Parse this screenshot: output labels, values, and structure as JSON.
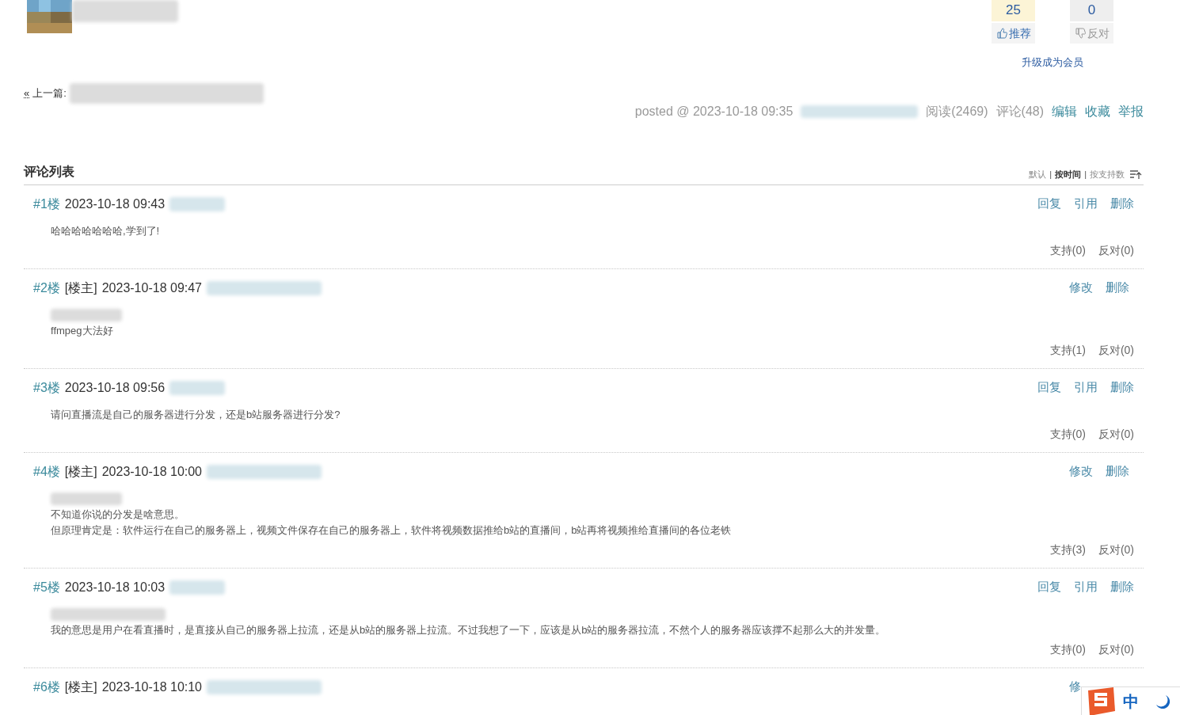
{
  "votes": [
    {
      "count": "25",
      "label": "推荐",
      "kind": "up"
    },
    {
      "count": "0",
      "label": "反对",
      "kind": "down"
    }
  ],
  "upgrade_link": "升级成为会员",
  "prev_post": {
    "arrow": "«",
    "label": "上一篇:"
  },
  "post_meta": {
    "posted": "posted @ 2023-10-18 09:35",
    "reads": "阅读(2469)",
    "comments": "评论(48)",
    "links": [
      "编辑",
      "收藏",
      "举报"
    ]
  },
  "comment_list": {
    "title": "评论列表",
    "separator": "|",
    "sort_options": [
      {
        "label": "默认",
        "selected": false
      },
      {
        "label": "按时间",
        "selected": true
      },
      {
        "label": "按支持数",
        "selected": false
      }
    ]
  },
  "comments": [
    {
      "floor": "#1楼",
      "time": "2023-10-18 09:43",
      "body": [
        "哈哈哈哈哈哈哈,学到了!"
      ],
      "actions": [
        "回复",
        "引用",
        "删除"
      ],
      "votes": [
        "支持(0)",
        "反对(0)"
      ]
    },
    {
      "floor": "#2楼",
      "owner_tag": "[楼主]",
      "time": "2023-10-18 09:47",
      "quote": true,
      "body": [
        "ffmpeg大法好"
      ],
      "actions": [
        "修改",
        "删除"
      ],
      "votes": [
        "支持(1)",
        "反对(0)"
      ]
    },
    {
      "floor": "#3楼",
      "time": "2023-10-18 09:56",
      "body": [
        "请问直播流是自己的服务器进行分发，还是b站服务器进行分发?"
      ],
      "actions": [
        "回复",
        "引用",
        "删除"
      ],
      "votes": [
        "支持(0)",
        "反对(0)"
      ]
    },
    {
      "floor": "#4楼",
      "owner_tag": "[楼主]",
      "time": "2023-10-18 10:00",
      "quote": true,
      "body": [
        "不知道你说的分发是啥意思。",
        "但原理肯定是：软件运行在自己的服务器上，视频文件保存在自己的服务器上，软件将视频数据推给b站的直播间，b站再将视频推给直播间的各位老铁"
      ],
      "actions": [
        "修改",
        "删除"
      ],
      "votes": [
        "支持(3)",
        "反对(0)"
      ]
    },
    {
      "floor": "#5楼",
      "time": "2023-10-18 10:03",
      "quote": true,
      "body": [
        "我的意思是用户在看直播时，是直接从自己的服务器上拉流，还是从b站的服务器上拉流。不过我想了一下，应该是从b站的服务器拉流，不然个人的服务器应该撑不起那么大的并发量。"
      ],
      "actions": [
        "回复",
        "引用",
        "删除"
      ],
      "votes": [
        "支持(0)",
        "反对(0)"
      ]
    },
    {
      "floor": "#6楼",
      "owner_tag": "[楼主]",
      "time": "2023-10-18 10:10",
      "actions": [
        "修"
      ]
    }
  ],
  "ime_bar": {
    "mode": "中"
  }
}
